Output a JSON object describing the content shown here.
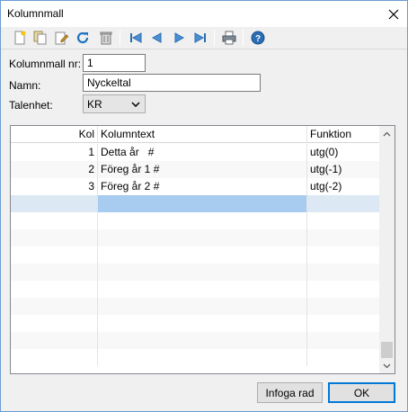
{
  "window": {
    "title": "Kolumnmall"
  },
  "toolbar": {
    "icons": [
      "new-icon",
      "copy-icon",
      "edit-icon",
      "refresh-icon",
      "delete-icon",
      "first-icon",
      "prev-icon",
      "next-icon",
      "last-icon",
      "print-icon",
      "help-icon"
    ]
  },
  "form": {
    "nr_label": "Kolumnmall nr:",
    "nr_value": "1",
    "name_label": "Namn:",
    "name_value": "Nyckeltal",
    "unit_label": "Talenhet:",
    "unit_value": "KR"
  },
  "grid": {
    "columns": [
      "Kol",
      "Kolumntext",
      "Funktion"
    ],
    "rows": [
      {
        "kol": "1",
        "text": "Detta år   #",
        "func": "utg(0)"
      },
      {
        "kol": "2",
        "text": "Föreg år 1 #",
        "func": "utg(-1)"
      },
      {
        "kol": "3",
        "text": "Föreg år 2 #",
        "func": "utg(-2)"
      }
    ]
  },
  "buttons": {
    "insert": "Infoga rad",
    "ok": "OK"
  },
  "colors": {
    "selection": "#a8cbf0",
    "selection_light": "#dde8f5",
    "accent": "#0078d7"
  }
}
